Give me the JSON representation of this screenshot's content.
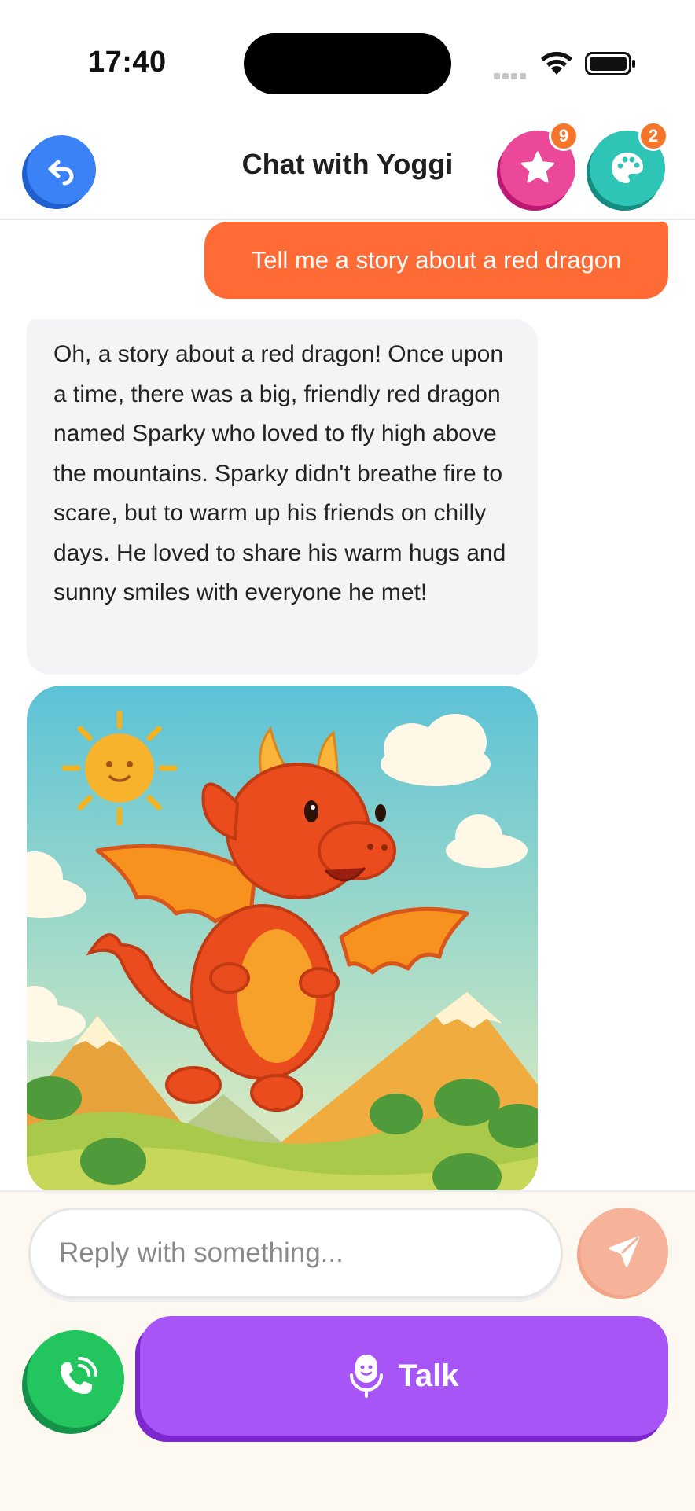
{
  "status_bar": {
    "time": "17:40"
  },
  "header": {
    "title": "Chat with Yoggi",
    "stars_count": "9",
    "palette_count": "2"
  },
  "messages": {
    "user_message": "Tell me a story about a red dragon",
    "bot_message": "Oh, a story about a red dragon! Once upon a time, there was a big, friendly red dragon named Sparky who loved to fly high above the mountains. Sparky didn't breathe fire to scare, but to warm up his friends on chilly days. He loved to share his warm hugs and sunny smiles with everyone he met!"
  },
  "composer": {
    "placeholder": "Reply with something...",
    "talk_label": "Talk"
  },
  "icons": {
    "back": "undo-arrow-icon",
    "stars": "star-icon",
    "palette": "palette-icon",
    "send": "paper-plane-icon",
    "call": "phone-call-icon",
    "talk": "microphone-icon"
  },
  "colors": {
    "accent_orange": "#ff6b35",
    "back_blue": "#3b82f6",
    "stars_pink": "#ec4899",
    "palette_teal": "#2ec4b6",
    "badge_orange": "#f5762b",
    "send_peach": "#f7b39a",
    "call_green": "#22c55e",
    "talk_purple": "#a855f7",
    "composer_bg": "#fdf8f0"
  }
}
